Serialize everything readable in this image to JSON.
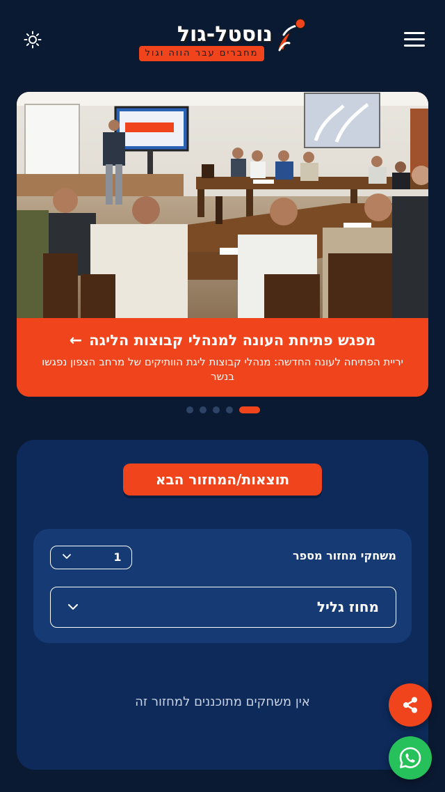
{
  "header": {
    "logo_main": "נוסטל-גול",
    "logo_sub": "מחברים עבר הווה וגול",
    "theme_icon": "sun-icon",
    "menu_icon": "hamburger-menu-icon"
  },
  "hero": {
    "title": "מפגש פתיחת העונה למנהלי קבוצות הליגה",
    "arrow": "←",
    "text": "יריית הפתיחה לעונה החדשה: מנהלי קבוצות ליגת הוותיקים של מרחב הצפון נפגשו בנשר",
    "slides_total": 5,
    "active_slide": 5
  },
  "results": {
    "title": "תוצאות/המחזור הבא",
    "round_label": "משחקי מחזור מספר",
    "round_value": "1",
    "district_value": "מחוז גליל",
    "empty_message": "אין משחקים מתוכננים למחזור זה"
  },
  "fabs": {
    "share_icon": "share-icon",
    "whatsapp_icon": "whatsapp-icon"
  },
  "colors": {
    "background": "#0b1a33",
    "accent": "#f0441c",
    "panel": "#0e2a5a",
    "filter_box": "#163a73",
    "whatsapp": "#27c15b"
  }
}
